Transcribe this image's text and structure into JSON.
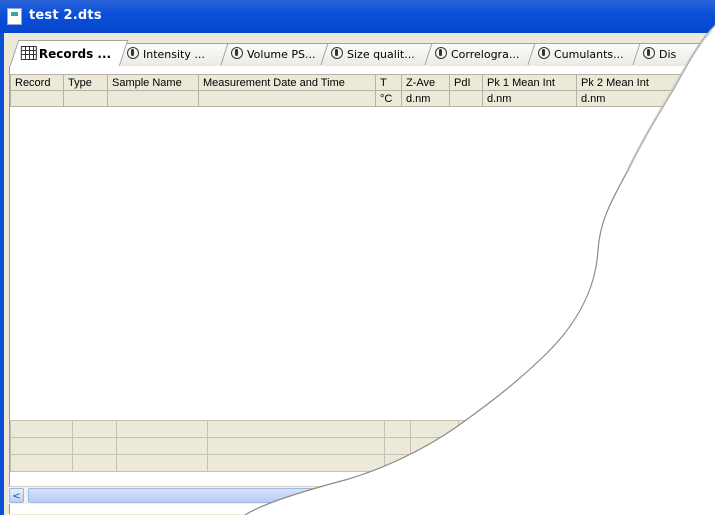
{
  "window": {
    "title": "test 2.dts"
  },
  "tabs": [
    {
      "label": "Records ...",
      "active": true
    },
    {
      "label": "Intensity ..."
    },
    {
      "label": "Volume PS..."
    },
    {
      "label": "Size qualit..."
    },
    {
      "label": "Correlogra..."
    },
    {
      "label": "Cumulants..."
    },
    {
      "label": "Dis"
    }
  ],
  "table": {
    "headers": [
      "Record",
      "Type",
      "Sample Name",
      "Measurement Date and Time",
      "T",
      "Z-Ave",
      "PdI",
      "Pk 1 Mean Int",
      "Pk 2 Mean Int"
    ],
    "units": [
      "",
      "",
      "",
      "",
      "°C",
      "d.nm",
      "",
      "d.nm",
      "d.nm"
    ]
  },
  "scrollbar": {
    "left_arrow": "<"
  },
  "colors": {
    "titlebar": "#0a4fd9",
    "panel_bg": "#ece9d8"
  }
}
